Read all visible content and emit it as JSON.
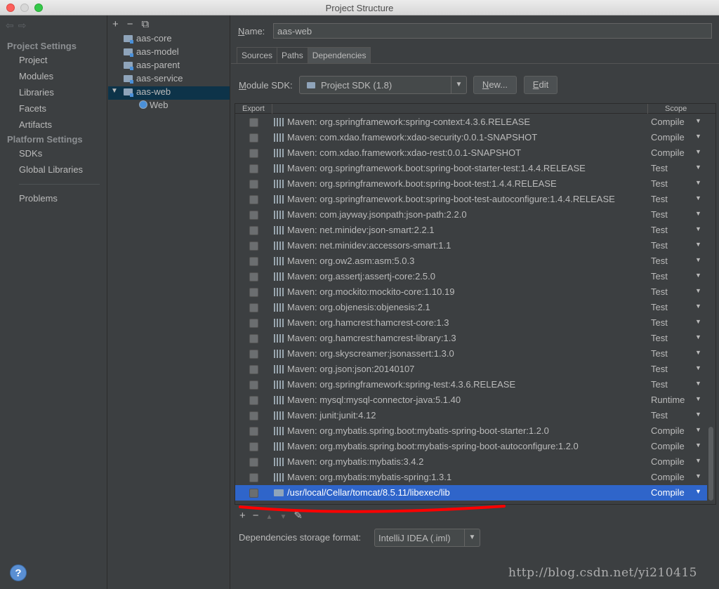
{
  "window": {
    "title": "Project Structure"
  },
  "nav": {
    "back_icon": "back-arrow-icon",
    "forward_icon": "forward-arrow-icon",
    "project_settings_header": "Project Settings",
    "project_settings": [
      "Project",
      "Modules",
      "Libraries",
      "Facets",
      "Artifacts"
    ],
    "platform_settings_header": "Platform Settings",
    "platform_settings": [
      "SDKs",
      "Global Libraries"
    ],
    "problems": "Problems"
  },
  "modules": {
    "toolbar": {
      "add": "+",
      "remove": "−",
      "copy": "⧉"
    },
    "items": [
      "aas-core",
      "aas-model",
      "aas-parent",
      "aas-service",
      "aas-web"
    ],
    "selected": "aas-web",
    "child": "Web"
  },
  "main": {
    "name_label_prefix": "N",
    "name_label_rest": "ame:",
    "name_value": "aas-web",
    "tabs": [
      "Sources",
      "Paths",
      "Dependencies"
    ],
    "active_tab": "Dependencies",
    "sdk_label_prefix": "M",
    "sdk_label_rest": "odule SDK:",
    "sdk_value": "Project SDK (1.8)",
    "new_prefix": "N",
    "new_rest": "ew...",
    "edit_prefix": "E",
    "edit_rest": "dit"
  },
  "table": {
    "headers": {
      "export": "Export",
      "scope": "Scope"
    },
    "rows": [
      {
        "name": "Maven: org.springframework:spring-context:4.3.6.RELEASE",
        "scope": "Compile"
      },
      {
        "name": "Maven: com.xdao.framework:xdao-security:0.0.1-SNAPSHOT",
        "scope": "Compile"
      },
      {
        "name": "Maven: com.xdao.framework:xdao-rest:0.0.1-SNAPSHOT",
        "scope": "Compile"
      },
      {
        "name": "Maven: org.springframework.boot:spring-boot-starter-test:1.4.4.RELEASE",
        "scope": "Test"
      },
      {
        "name": "Maven: org.springframework.boot:spring-boot-test:1.4.4.RELEASE",
        "scope": "Test"
      },
      {
        "name": "Maven: org.springframework.boot:spring-boot-test-autoconfigure:1.4.4.RELEASE",
        "scope": "Test"
      },
      {
        "name": "Maven: com.jayway.jsonpath:json-path:2.2.0",
        "scope": "Test"
      },
      {
        "name": "Maven: net.minidev:json-smart:2.2.1",
        "scope": "Test"
      },
      {
        "name": "Maven: net.minidev:accessors-smart:1.1",
        "scope": "Test"
      },
      {
        "name": "Maven: org.ow2.asm:asm:5.0.3",
        "scope": "Test"
      },
      {
        "name": "Maven: org.assertj:assertj-core:2.5.0",
        "scope": "Test"
      },
      {
        "name": "Maven: org.mockito:mockito-core:1.10.19",
        "scope": "Test"
      },
      {
        "name": "Maven: org.objenesis:objenesis:2.1",
        "scope": "Test"
      },
      {
        "name": "Maven: org.hamcrest:hamcrest-core:1.3",
        "scope": "Test"
      },
      {
        "name": "Maven: org.hamcrest:hamcrest-library:1.3",
        "scope": "Test"
      },
      {
        "name": "Maven: org.skyscreamer:jsonassert:1.3.0",
        "scope": "Test"
      },
      {
        "name": "Maven: org.json:json:20140107",
        "scope": "Test"
      },
      {
        "name": "Maven: org.springframework:spring-test:4.3.6.RELEASE",
        "scope": "Test"
      },
      {
        "name": "Maven: mysql:mysql-connector-java:5.1.40",
        "scope": "Runtime"
      },
      {
        "name": "Maven: junit:junit:4.12",
        "scope": "Test"
      },
      {
        "name": "Maven: org.mybatis.spring.boot:mybatis-spring-boot-starter:1.2.0",
        "scope": "Compile"
      },
      {
        "name": "Maven: org.mybatis.spring.boot:mybatis-spring-boot-autoconfigure:1.2.0",
        "scope": "Compile"
      },
      {
        "name": "Maven: org.mybatis:mybatis:3.4.2",
        "scope": "Compile"
      },
      {
        "name": "Maven: org.mybatis:mybatis-spring:1.3.1",
        "scope": "Compile"
      },
      {
        "name": "/usr/local/Cellar/tomcat/8.5.11/libexec/lib",
        "scope": "Compile",
        "selected": true
      }
    ],
    "toolbar": {
      "add": "+",
      "remove": "−",
      "up": "▲",
      "down": "▼",
      "edit": "✎"
    }
  },
  "storage": {
    "label": "Dependencies storage format:",
    "value": "IntelliJ IDEA (.iml)"
  },
  "footer": {
    "help": "?",
    "watermark": "http://blog.csdn.net/yi210415"
  },
  "colors": {
    "selection": "#2f65ca",
    "module_selection": "#0d3349",
    "annotation": "#ff0000"
  }
}
